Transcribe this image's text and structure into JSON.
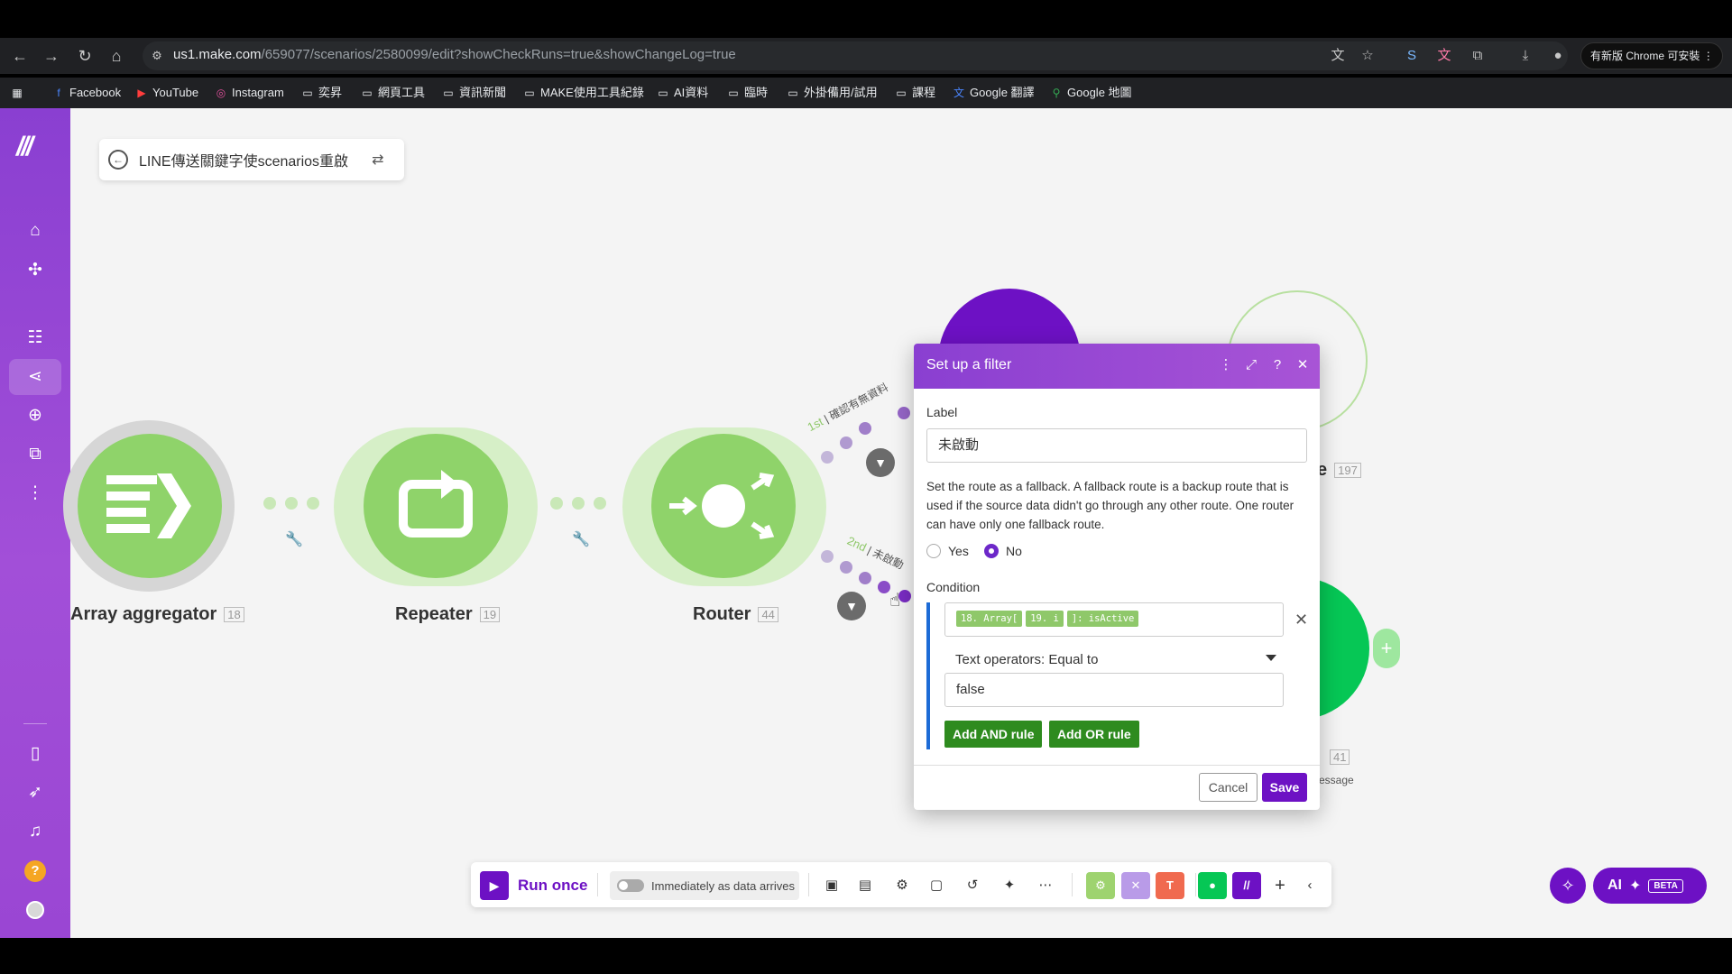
{
  "browser": {
    "url_host": "us1.make.com",
    "url_path": "/659077/scenarios/2580099/edit?showCheckRuns=true&showChangeLog=true",
    "update_button": "有新版 Chrome 可安裝"
  },
  "bookmarks": [
    {
      "label": "Facebook",
      "icon": "facebook-icon"
    },
    {
      "label": "YouTube",
      "icon": "youtube-icon"
    },
    {
      "label": "Instagram",
      "icon": "instagram-icon"
    },
    {
      "label": "奕昇",
      "icon": "folder-icon"
    },
    {
      "label": "網頁工具",
      "icon": "folder-icon"
    },
    {
      "label": "資訊新聞",
      "icon": "folder-icon"
    },
    {
      "label": "MAKE使用工具紀錄",
      "icon": "folder-icon"
    },
    {
      "label": "AI資料",
      "icon": "folder-icon"
    },
    {
      "label": "臨時",
      "icon": "folder-icon"
    },
    {
      "label": "外掛備用/試用",
      "icon": "folder-icon"
    },
    {
      "label": "課程",
      "icon": "folder-icon"
    },
    {
      "label": "Google 翻譯",
      "icon": "translate-icon"
    },
    {
      "label": "Google 地圖",
      "icon": "maps-icon"
    }
  ],
  "scenario": {
    "title": "LINE傳送關鍵字使scenarios重啟"
  },
  "modules": [
    {
      "label": "Array aggregator",
      "id": "18"
    },
    {
      "label": "Repeater",
      "id": "19"
    },
    {
      "label": "Router",
      "id": "44"
    },
    {
      "label": "e",
      "id": "197"
    },
    {
      "label": "essage",
      "id": "41"
    }
  ],
  "routes": [
    {
      "order": "1st",
      "label": "確認有無資料"
    },
    {
      "order": "2nd",
      "label": "未啟動"
    }
  ],
  "filter_dialog": {
    "title": "Set up a filter",
    "label_caption": "Label",
    "label_value": "未啟動",
    "fallback_help": "Set the route as a fallback. A fallback route is a backup route that is used if the source data didn't go through any other route. One router can have only one fallback route.",
    "yes": "Yes",
    "no": "No",
    "fallback_selected": "No",
    "condition_caption": "Condition",
    "condition_pills": [
      "18. Array[",
      "19. i",
      "]: isActive"
    ],
    "operator": "Text operators: Equal to",
    "value": "false",
    "add_and": "Add AND rule",
    "add_or": "Add OR rule",
    "cancel": "Cancel",
    "save": "Save"
  },
  "bottom_toolbar": {
    "run_once": "Run once",
    "schedule": "Immediately as data arrives"
  },
  "ai_button": {
    "label": "AI",
    "badge": "BETA"
  },
  "colors": {
    "make_purple": "#6d11c4",
    "module_green": "#8fd36a",
    "line_green": "#06c755"
  }
}
